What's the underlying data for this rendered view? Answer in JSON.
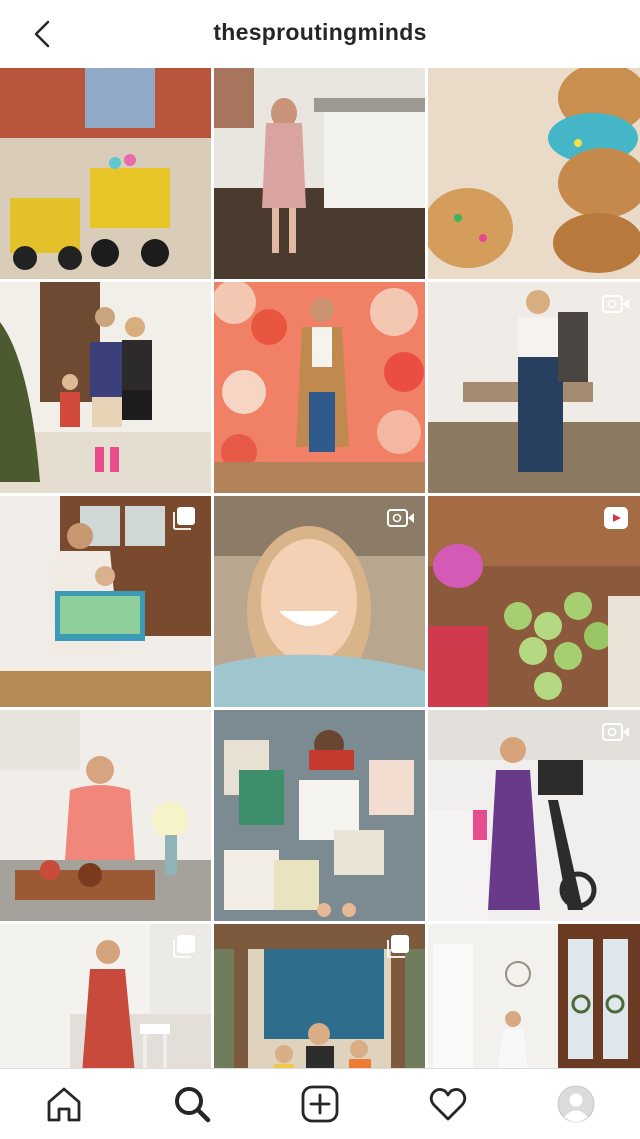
{
  "header": {
    "username": "thesproutingminds",
    "back_icon": "chevron-left-icon"
  },
  "grid": {
    "posts": [
      {
        "id": "post-1",
        "badge": "",
        "colors": [
          "#c9b79f",
          "#e3c12a",
          "#b5533a"
        ]
      },
      {
        "id": "post-2",
        "badge": "",
        "colors": [
          "#e8e4df",
          "#d9a3a0",
          "#4b3a2e"
        ]
      },
      {
        "id": "post-3",
        "badge": "",
        "colors": [
          "#ead3b4",
          "#c98f4f",
          "#45b6c7"
        ]
      },
      {
        "id": "post-4",
        "badge": "",
        "colors": [
          "#f2eee8",
          "#4c5a2f",
          "#3b3f7a"
        ]
      },
      {
        "id": "post-5",
        "badge": "",
        "colors": [
          "#f08066",
          "#f4c7b2",
          "#c08a4e"
        ]
      },
      {
        "id": "post-6",
        "badge": "video",
        "colors": [
          "#efebe6",
          "#27405f",
          "#8c7a63"
        ]
      },
      {
        "id": "post-7",
        "badge": "carousel",
        "colors": [
          "#f0ece7",
          "#7a4a2e",
          "#3b9bb6"
        ]
      },
      {
        "id": "post-8",
        "badge": "video",
        "colors": [
          "#b9a68f",
          "#f4d0b5",
          "#9fc5cf"
        ]
      },
      {
        "id": "post-9",
        "badge": "reel",
        "colors": [
          "#8b5a3c",
          "#a6cf72",
          "#cf3b4d"
        ]
      },
      {
        "id": "post-10",
        "badge": "",
        "colors": [
          "#f1eeea",
          "#f0877a",
          "#9b5a34"
        ]
      },
      {
        "id": "post-11",
        "badge": "",
        "colors": [
          "#7c8a92",
          "#e7e0d3",
          "#3d8f6c"
        ]
      },
      {
        "id": "post-12",
        "badge": "video",
        "colors": [
          "#f1efed",
          "#6a3a8a",
          "#2c2c2c"
        ]
      },
      {
        "id": "post-13",
        "badge": "carousel",
        "colors": [
          "#f4f2ef",
          "#c84a3d",
          "#6f4a33"
        ]
      },
      {
        "id": "post-14",
        "badge": "carousel",
        "colors": [
          "#7d5a3e",
          "#2e6e8c",
          "#e0d3bd"
        ]
      },
      {
        "id": "post-15",
        "badge": "",
        "colors": [
          "#f3f1ee",
          "#6b3a22",
          "#dfe6ec"
        ]
      }
    ]
  },
  "nav": {
    "items": [
      {
        "name": "home",
        "icon": "home-icon"
      },
      {
        "name": "search",
        "icon": "search-icon"
      },
      {
        "name": "new-post",
        "icon": "add-post-icon"
      },
      {
        "name": "activity",
        "icon": "heart-icon"
      },
      {
        "name": "profile",
        "icon": "avatar-icon"
      }
    ]
  },
  "colors": {
    "text": "#262626",
    "divider": "#dbdbdb",
    "background": "#ffffff"
  }
}
